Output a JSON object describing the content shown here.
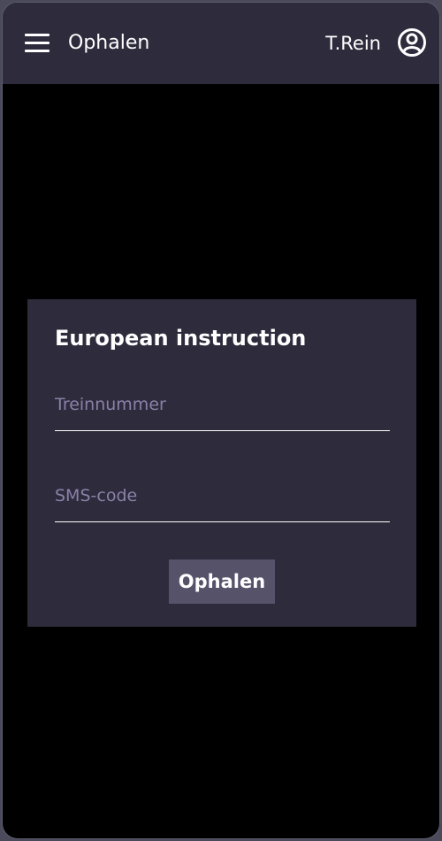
{
  "header": {
    "menu_icon": "hamburger-menu-icon",
    "title": "Ophalen",
    "user_name": "T.Rein",
    "account_icon": "user-circle-icon"
  },
  "form": {
    "title": "European instruction",
    "train_number": {
      "placeholder": "Treinnummer",
      "value": ""
    },
    "sms_code": {
      "placeholder": "SMS-code",
      "value": ""
    },
    "submit_label": "Ophalen"
  },
  "colors": {
    "header_background": "#2e2b3c",
    "page_background": "#000000",
    "card_background": "#2e2b3c",
    "placeholder": "#8a81a8",
    "button_background": "#55526a"
  }
}
